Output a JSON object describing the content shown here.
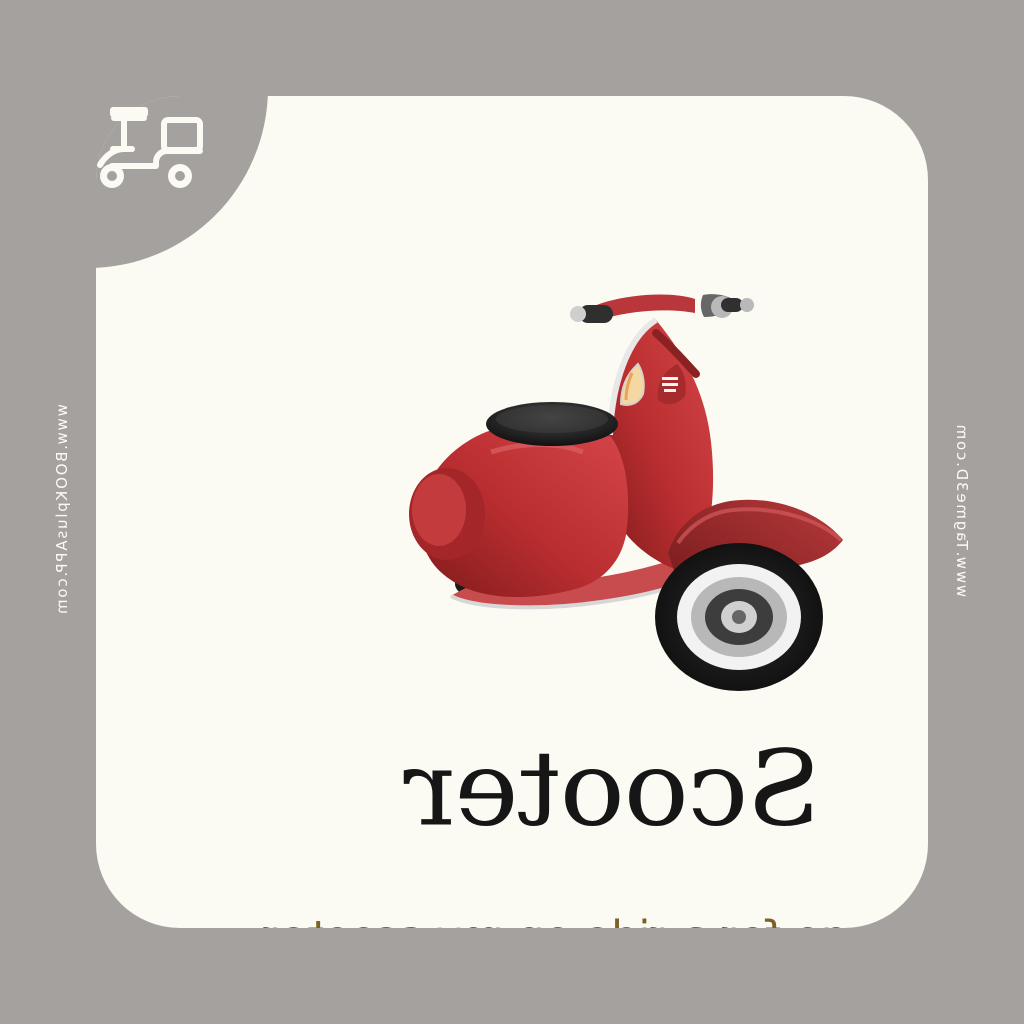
{
  "card": {
    "title": "Scooter",
    "sentence": "Let's go for a ride on my scooter."
  },
  "footer": {
    "left_url": "www.BOOKplusAPP.com",
    "right_url": "www.Tagme3D.com"
  },
  "icons": {
    "corner": "scooter-icon",
    "illustration": "red-scooter-illustration"
  },
  "colors": {
    "background": "#a5a19e",
    "card": "#fcfbf3",
    "accent_text": "#7a6225",
    "scooter_red": "#b52c2d"
  }
}
